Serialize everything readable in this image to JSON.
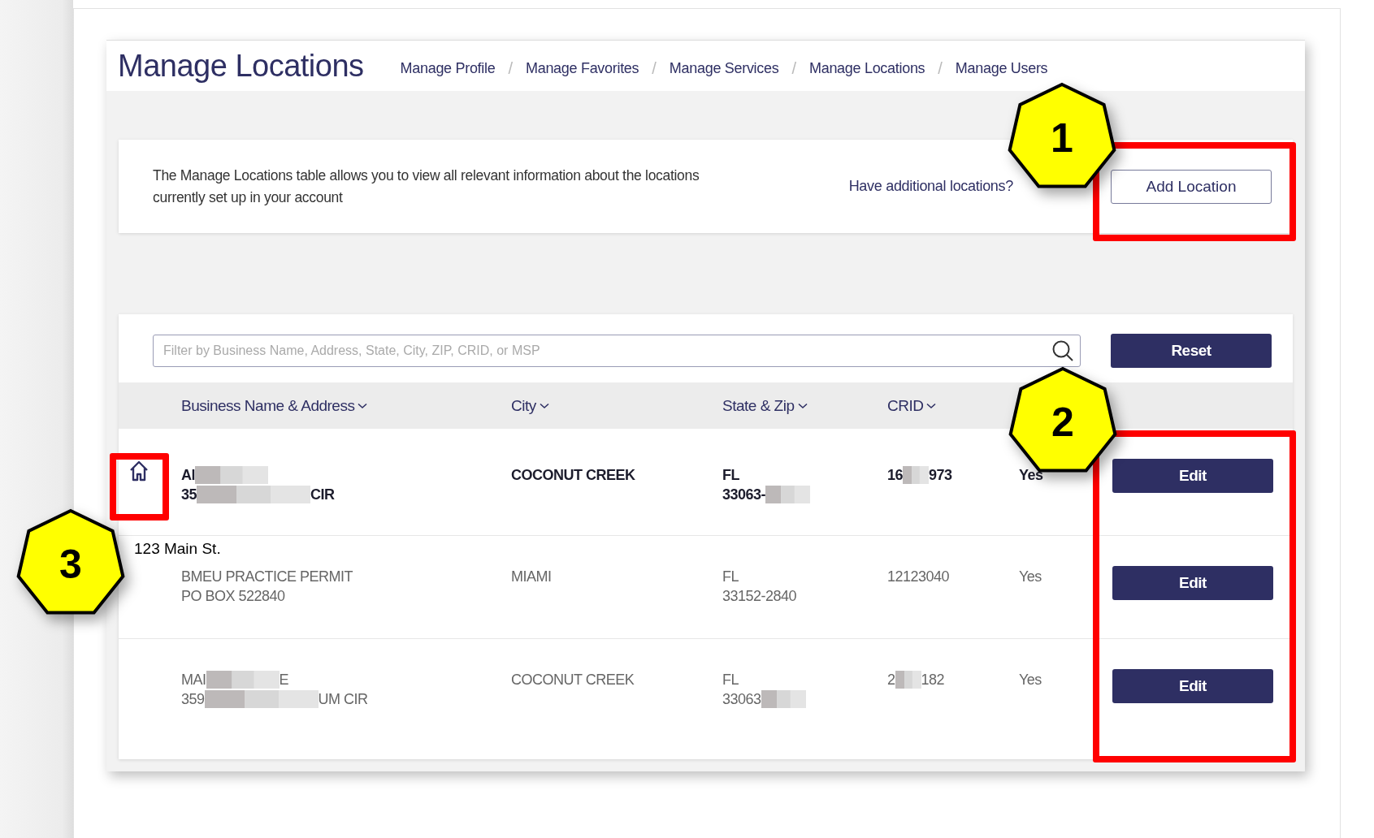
{
  "header": {
    "title": "Manage Locations",
    "separator": "/",
    "breadcrumbs": [
      {
        "label": "Manage Profile"
      },
      {
        "label": "Manage Favorites"
      },
      {
        "label": "Manage Services"
      },
      {
        "label": "Manage Locations"
      },
      {
        "label": "Manage Users"
      }
    ]
  },
  "info": {
    "text": "The Manage Locations table allows you to view all relevant information about the locations currently set up in your account",
    "prompt": "Have additional locations?",
    "button": "Add Location"
  },
  "filter": {
    "placeholder": "Filter by Business Name, Address, State, City, ZIP, CRID, or MSP",
    "button": "Reset"
  },
  "table": {
    "columns": [
      "Business Name & Address",
      "City",
      "State & Zip",
      "CRID"
    ],
    "rows": [
      {
        "primary": true,
        "name": [
          {
            "kind": "text",
            "text": "Al"
          },
          {
            "kind": "redaction"
          }
        ],
        "address": [
          {
            "kind": "text",
            "text": "35"
          },
          {
            "kind": "redaction"
          },
          {
            "kind": "text",
            "text": "CIR"
          }
        ],
        "city": "COCONUT CREEK",
        "state": "FL",
        "zip": [
          {
            "kind": "text",
            "text": "33063-"
          },
          {
            "kind": "redaction"
          }
        ],
        "crid": [
          {
            "kind": "text",
            "text": "16"
          },
          {
            "kind": "redaction"
          },
          {
            "kind": "text",
            "text": "973"
          }
        ],
        "column_5": "Yes",
        "button": "Edit"
      },
      {
        "primary": false,
        "name": [
          {
            "kind": "text",
            "text": "BMEU PRACTICE PERMIT"
          }
        ],
        "address": [
          {
            "kind": "text",
            "text": "PO BOX 522840"
          }
        ],
        "city": "MIAMI",
        "state": "FL",
        "zip": [
          {
            "kind": "text",
            "text": "33152-2840"
          }
        ],
        "crid": [
          {
            "kind": "text",
            "text": "12123040"
          }
        ],
        "column_5": "Yes",
        "button": "Edit"
      },
      {
        "primary": false,
        "name": [
          {
            "kind": "text",
            "text": "MAI"
          },
          {
            "kind": "redaction"
          },
          {
            "kind": "text",
            "text": "E"
          }
        ],
        "address": [
          {
            "kind": "text",
            "text": "359"
          },
          {
            "kind": "redaction"
          },
          {
            "kind": "text",
            "text": "UM CIR"
          }
        ],
        "city": "COCONUT CREEK",
        "state": "FL",
        "zip": [
          {
            "kind": "text",
            "text": "33063"
          },
          {
            "kind": "redaction"
          }
        ],
        "crid": [
          {
            "kind": "text",
            "text": "2"
          },
          {
            "kind": "redaction"
          },
          {
            "kind": "text",
            "text": "182"
          }
        ],
        "column_5": "Yes",
        "button": "Edit"
      }
    ]
  },
  "annotations": [
    {
      "number": "1"
    },
    {
      "number": "2"
    },
    {
      "number": "3"
    }
  ],
  "note": "123 Main St."
}
